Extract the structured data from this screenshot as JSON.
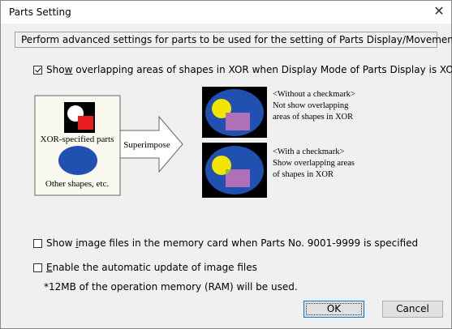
{
  "window": {
    "title": "Parts Setting",
    "close_glyph": "✕"
  },
  "description": "Perform advanced settings for parts to be used for the setting of Parts Display/Movement.",
  "options": {
    "xor": {
      "label_pre": "Sho",
      "label_accel": "w",
      "label_post": " overlapping areas of shapes in XOR when Display Mode of Parts Display is XOR",
      "checked": true
    },
    "image_files": {
      "label_pre": "Show ",
      "label_accel": "i",
      "label_post": "mage files in the memory card when Parts No. 9001-9999 is specified",
      "checked": false
    },
    "auto_update": {
      "label_pre": "",
      "label_accel": "E",
      "label_post": "nable the automatic update of image files",
      "checked": false
    }
  },
  "illustration": {
    "xor_parts_label": "XOR-specified parts",
    "other_shapes_label": "Other shapes, etc.",
    "superimpose_label": "Superimpose",
    "without_checkmark": [
      "<Without a checkmark>",
      "Not show overlapping",
      "areas of shapes in XOR"
    ],
    "with_checkmark": [
      "<With a checkmark>",
      "Show overlapping areas",
      "of shapes in XOR"
    ],
    "colors": {
      "blue": "#2050b0",
      "yellow": "#f2e500",
      "purple": "#b070b8",
      "red": "#e81c1c",
      "green": "#8fbf3a",
      "black": "#000000",
      "panel": "#f8f8ee"
    }
  },
  "note": "*12MB of the operation memory (RAM) will be used.",
  "buttons": {
    "ok": "OK",
    "cancel": "Cancel"
  }
}
